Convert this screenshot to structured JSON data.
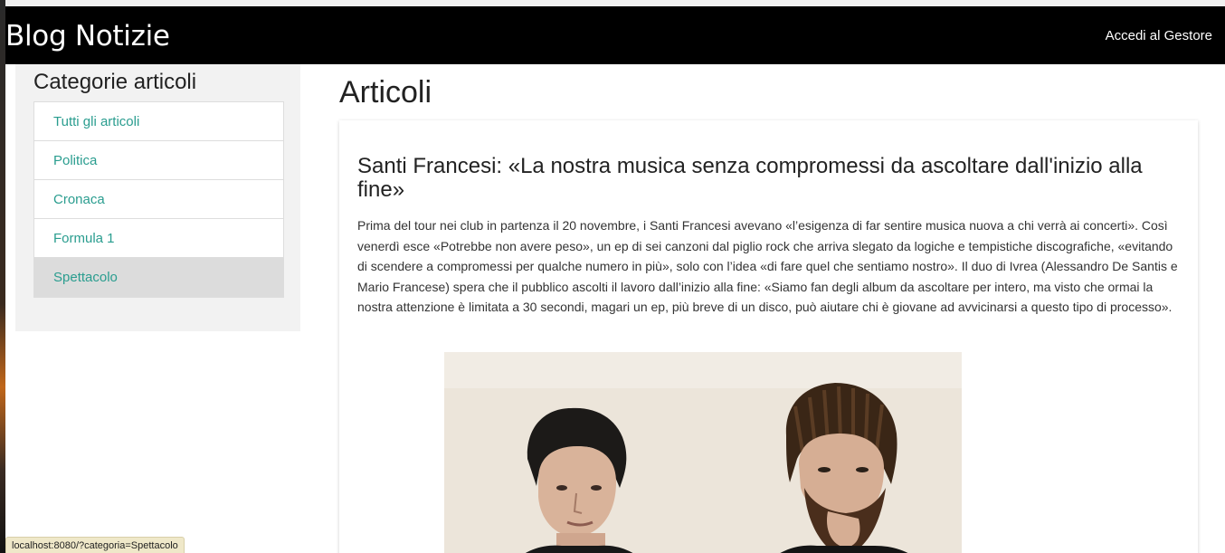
{
  "header": {
    "brand": "Blog Notizie",
    "login_link": "Accedi al Gestore"
  },
  "sidebar": {
    "title": "Categorie articoli",
    "items": [
      {
        "label": "Tutti gli articoli"
      },
      {
        "label": "Politica"
      },
      {
        "label": "Cronaca"
      },
      {
        "label": "Formula 1"
      },
      {
        "label": "Spettacolo"
      }
    ],
    "active_item": "Spettacolo"
  },
  "main": {
    "title": "Articoli",
    "article": {
      "title": "Santi Francesi: «La nostra musica senza compromessi da ascoltare dall'inizio alla fine»",
      "body": "Prima del tour nei club in partenza il 20 novembre, i Santi Francesi avevano «l’esigenza di far sentire musica nuova a chi verrà ai concerti». Così venerdì esce «Potrebbe non avere peso», un ep di sei canzoni dal piglio rock che arriva slegato da logiche e tempistiche discografiche, «evitando di scendere a compromessi per qualche numero in più», solo con l’idea «di fare quel che sentiamo nostro». Il duo di Ivrea (Alessandro De Santis e Mario Francese) spera che il pubblico ascolti il lavoro dall’inizio alla fine: «Siamo fan degli album da ascoltare per intero, ma visto che ormai la nostra attenzione è limitata a 30 secondi, magari un ep, più breve di un disco, può aiutare chi è giovane ad avvicinarsi a questo tipo di processo»."
    }
  },
  "status_bar": {
    "url": "localhost:8080/?categoria=Spettacolo"
  },
  "colors": {
    "navbar_bg": "#000000",
    "link_color": "#2a9d8f",
    "sidebar_bg": "#f2f2f2",
    "active_item_bg": "#dcdcdc"
  }
}
